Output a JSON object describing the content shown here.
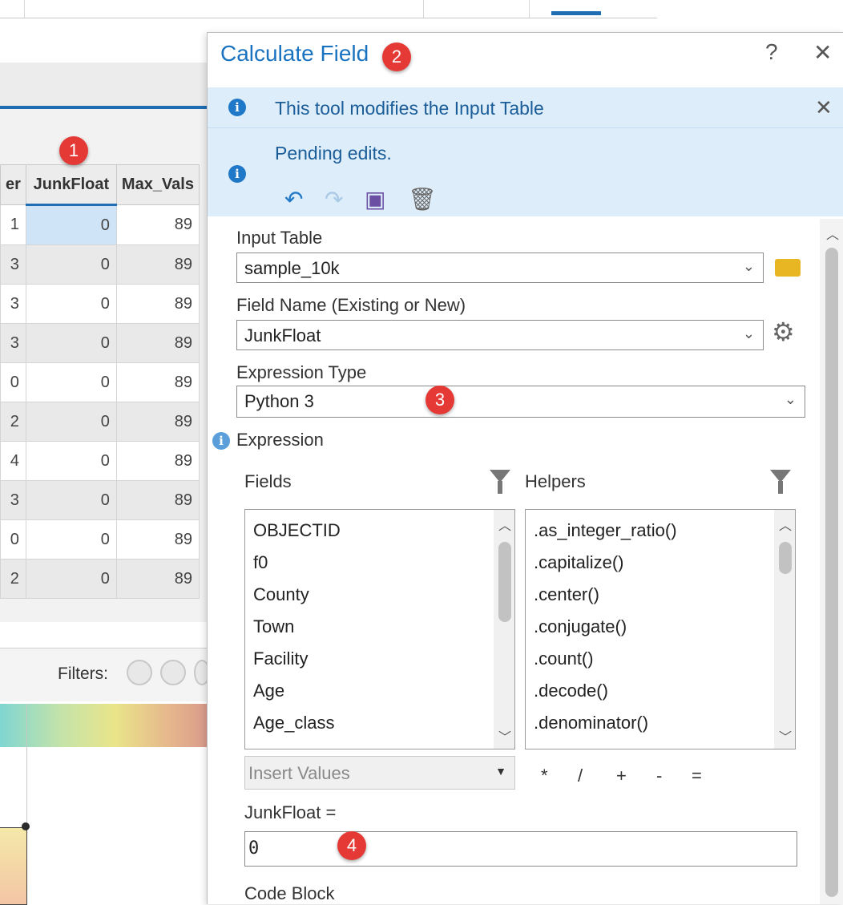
{
  "table": {
    "columns": [
      "er",
      "JunkFloat",
      "Max_Vals"
    ],
    "rows": [
      [
        "1",
        "0",
        "89"
      ],
      [
        "3",
        "0",
        "89"
      ],
      [
        "3",
        "0",
        "89"
      ],
      [
        "3",
        "0",
        "89"
      ],
      [
        "0",
        "0",
        "89"
      ],
      [
        "2",
        "0",
        "89"
      ],
      [
        "4",
        "0",
        "89"
      ],
      [
        "3",
        "0",
        "89"
      ],
      [
        "0",
        "0",
        "89"
      ],
      [
        "2",
        "0",
        "89"
      ]
    ],
    "filters_label": "Filters:"
  },
  "badges": [
    "1",
    "2",
    "3",
    "4"
  ],
  "dialog": {
    "title": "Calculate Field",
    "help": "?",
    "close": "✕",
    "info_modifies": "This tool modifies the Input Table",
    "info_pending": "Pending edits.",
    "input_table": {
      "label": "Input Table",
      "value": "sample_10k"
    },
    "field_name": {
      "label": "Field Name (Existing or New)",
      "value": "JunkFloat"
    },
    "expression_type": {
      "label": "Expression Type",
      "value": "Python 3"
    },
    "expression_label": "Expression",
    "fields": {
      "label": "Fields",
      "items": [
        "OBJECTID",
        "f0",
        "County",
        "Town",
        "Facility",
        "Age",
        "Age_class"
      ]
    },
    "helpers": {
      "label": "Helpers",
      "items": [
        ".as_integer_ratio()",
        ".capitalize()",
        ".center()",
        ".conjugate()",
        ".count()",
        ".decode()",
        ".denominator()"
      ]
    },
    "insert_values": "Insert Values",
    "operators": [
      "*",
      "/",
      "+",
      "-",
      "="
    ],
    "expr_lhs": "JunkFloat =",
    "expr_value": "0",
    "code_block": "Code Block"
  }
}
